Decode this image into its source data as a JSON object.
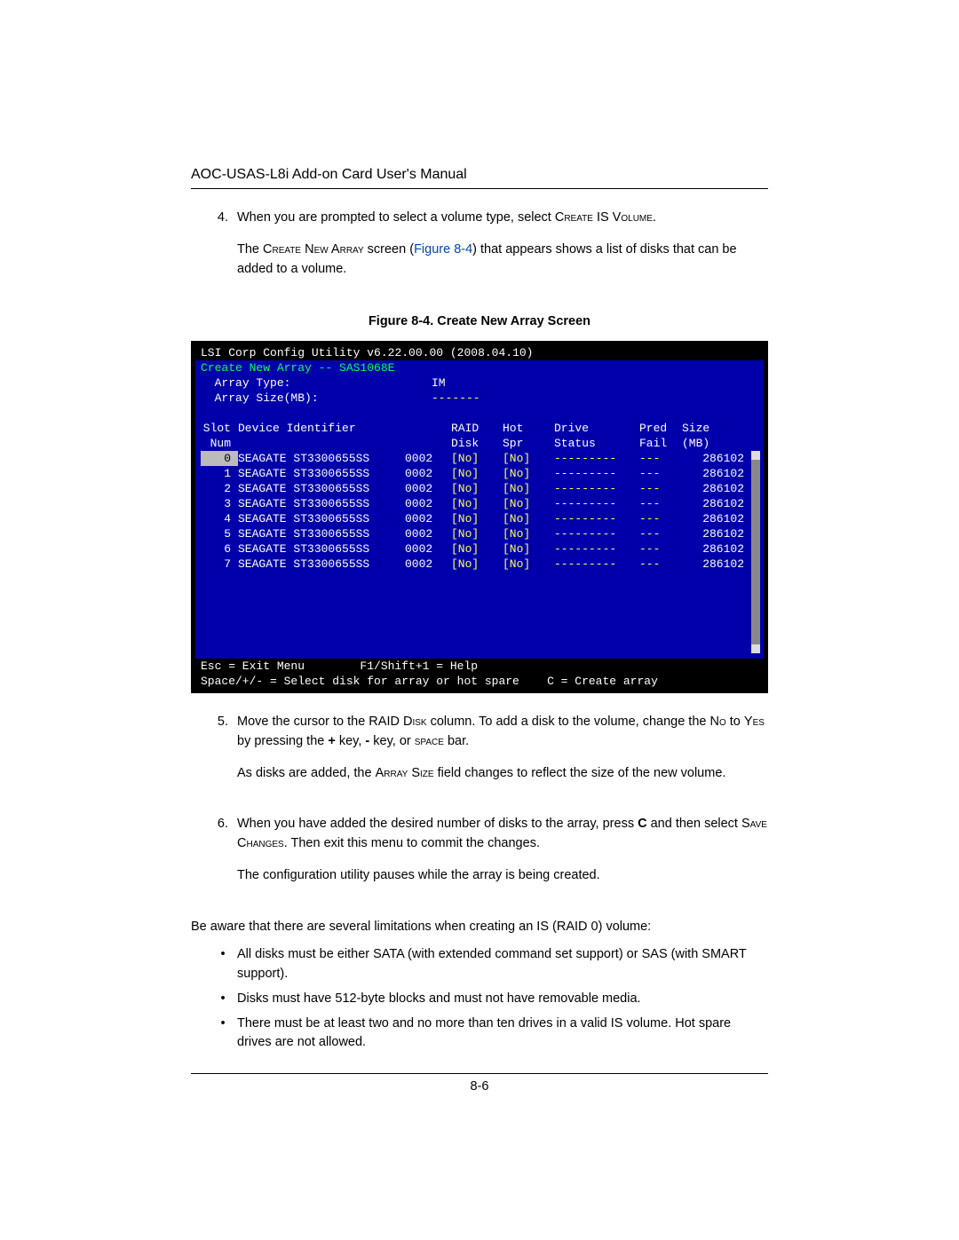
{
  "header": {
    "title": "AOC-USAS-L8i Add-on Card User's Manual"
  },
  "steps": {
    "s4": {
      "num": "4.",
      "p1a": "When you are prompted to select a volume type, select ",
      "p1b": "Create IS Volume",
      "p1c": ".",
      "p2a": "The ",
      "p2b": "Create New Array",
      "p2c": " screen (",
      "p2d": "Figure 8-4",
      "p2e": ") that appears shows a list of disks that can be added to a volume."
    },
    "s5": {
      "num": "5.",
      "p1a": "Move the cursor to the ",
      "p1b": "RAID Disk",
      "p1c": " column. To add a disk to the volume, change the ",
      "p1d": "No",
      "p1e": " to ",
      "p1f": "Yes",
      "p1g": " by pressing the ",
      "p1h": "+",
      "p1i": " key, ",
      "p1j": "-",
      "p1k": " key, or ",
      "p1l": "space",
      "p1m": " bar.",
      "p2a": "As disks are added, the ",
      "p2b": "Array Size",
      "p2c": " field changes to reflect the size of the new volume."
    },
    "s6": {
      "num": "6.",
      "p1a": "When you have added the desired number of disks to the array, press ",
      "p1b": "C",
      "p1c": " and then select ",
      "p1d": "Save Changes",
      "p1e": ". Then exit this menu to commit the changes.",
      "p2": "The configuration utility pauses while the array is being created."
    }
  },
  "figure_caption": "Figure 8-4. Create New Array Screen",
  "bios": {
    "title_left": "LSI Corp Config Utility",
    "title_right": "v6.22.00.00 (2008.04.10)",
    "subtitle": "Create New Array -- SAS1068E",
    "array_type_label": "Array Type:",
    "array_type_value": "IM",
    "array_size_label": "Array Size(MB):",
    "array_size_value": "-------",
    "headers": {
      "slot1": "Slot",
      "slot2": "Num",
      "dev": "Device Identifier",
      "raid1": "RAID",
      "raid2": "Disk",
      "hot1": "Hot",
      "hot2": "Spr",
      "drv1": "Drive",
      "drv2": "Status",
      "pred1": "Pred",
      "pred2": "Fail",
      "size1": "Size",
      "size2": "(MB)"
    },
    "rows": [
      {
        "slot": "0",
        "dev": "SEAGATE ST3300655SS",
        "fw": "0002",
        "raid": "[No]",
        "hot": "[No]",
        "drv": "---------",
        "pred": "---",
        "size": "286102",
        "sel": true
      },
      {
        "slot": "1",
        "dev": "SEAGATE ST3300655SS",
        "fw": "0002",
        "raid": "[No]",
        "hot": "[No]",
        "drv": "---------",
        "pred": "---",
        "size": "286102"
      },
      {
        "slot": "2",
        "dev": "SEAGATE ST3300655SS",
        "fw": "0002",
        "raid": "[No]",
        "hot": "[No]",
        "drv": "---------",
        "pred": "---",
        "size": "286102"
      },
      {
        "slot": "3",
        "dev": "SEAGATE ST3300655SS",
        "fw": "0002",
        "raid": "[No]",
        "hot": "[No]",
        "drv": "---------",
        "pred": "---",
        "size": "286102"
      },
      {
        "slot": "4",
        "dev": "SEAGATE ST3300655SS",
        "fw": "0002",
        "raid": "[No]",
        "hot": "[No]",
        "drv": "---------",
        "pred": "---",
        "size": "286102"
      },
      {
        "slot": "5",
        "dev": "SEAGATE ST3300655SS",
        "fw": "0002",
        "raid": "[No]",
        "hot": "[No]",
        "drv": "---------",
        "pred": "---",
        "size": "286102"
      },
      {
        "slot": "6",
        "dev": "SEAGATE ST3300655SS",
        "fw": "0002",
        "raid": "[No]",
        "hot": "[No]",
        "drv": "---------",
        "pred": "---",
        "size": "286102"
      },
      {
        "slot": "7",
        "dev": "SEAGATE ST3300655SS",
        "fw": "0002",
        "raid": "[No]",
        "hot": "[No]",
        "drv": "---------",
        "pred": "---",
        "size": "286102"
      }
    ],
    "footer1": "Esc = Exit Menu        F1/Shift+1 = Help",
    "footer2": "Space/+/- = Select disk for array or hot spare    C = Create array"
  },
  "limits": {
    "intro": "Be aware that there are several limitations when creating an IS (RAID 0) volume:",
    "b1": "All disks must be either SATA (with extended command set support) or SAS (with SMART support).",
    "b2": "Disks must have 512-byte blocks and must not have removable media.",
    "b3": "There must be at least two and no more than ten drives in a valid IS volume. Hot spare drives are not allowed."
  },
  "page_number": "8-6"
}
